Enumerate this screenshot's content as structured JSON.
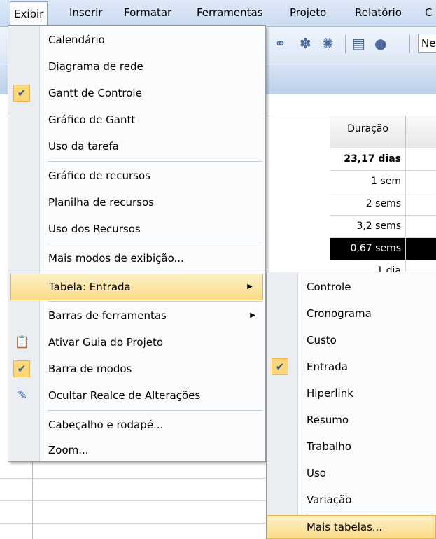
{
  "menubar": {
    "items": [
      "Exibir",
      "Inserir",
      "Formatar",
      "Ferramentas",
      "Projeto",
      "Relatório",
      "C"
    ]
  },
  "toolbar": {
    "icons": [
      "link-icon",
      "unlink-icon",
      "split-icon",
      "task-info-icon",
      "resources-icon"
    ],
    "font_value": "Ne"
  },
  "grid": {
    "column_header": "Duração",
    "rows": [
      "23,17 dias",
      "1 sem",
      "2 sems",
      "3,2 sems",
      "0,67 sems",
      "1 dia"
    ]
  },
  "view_menu": {
    "items": [
      {
        "label": "Calendário"
      },
      {
        "label": "Diagrama de rede"
      },
      {
        "label": "Gantt de Controle",
        "checked": true
      },
      {
        "label": "Gráfico de Gantt"
      },
      {
        "label": "Uso da tarefa"
      },
      {
        "label": "Gráfico de recursos"
      },
      {
        "label": "Planilha de recursos"
      },
      {
        "label": "Uso dos Recursos"
      },
      {
        "label": "Mais modos de exibição..."
      },
      {
        "label": "Tabela: Entrada",
        "submenu": true,
        "highlighted": true
      },
      {
        "label": "Barras de ferramentas",
        "submenu": true
      },
      {
        "label": "Ativar Guia do Projeto",
        "icon": "project-guide-icon"
      },
      {
        "label": "Barra de modos",
        "checked": true
      },
      {
        "label": "Ocultar Realce de Alterações",
        "icon": "highlight-pencil-icon"
      },
      {
        "label": "Cabeçalho e rodapé..."
      },
      {
        "label": "Zoom..."
      }
    ]
  },
  "table_submenu": {
    "items": [
      {
        "label": "Controle"
      },
      {
        "label": "Cronograma"
      },
      {
        "label": "Custo"
      },
      {
        "label": "Entrada",
        "checked": true
      },
      {
        "label": "Hiperlink"
      },
      {
        "label": "Resumo"
      },
      {
        "label": "Trabalho"
      },
      {
        "label": "Uso"
      },
      {
        "label": "Variação"
      },
      {
        "label": "Mais tabelas...",
        "highlighted": true
      }
    ]
  },
  "colors": {
    "menu_highlight": "#fbdc8a",
    "check_background": "#fcd67a",
    "selected_row": "#000000"
  }
}
